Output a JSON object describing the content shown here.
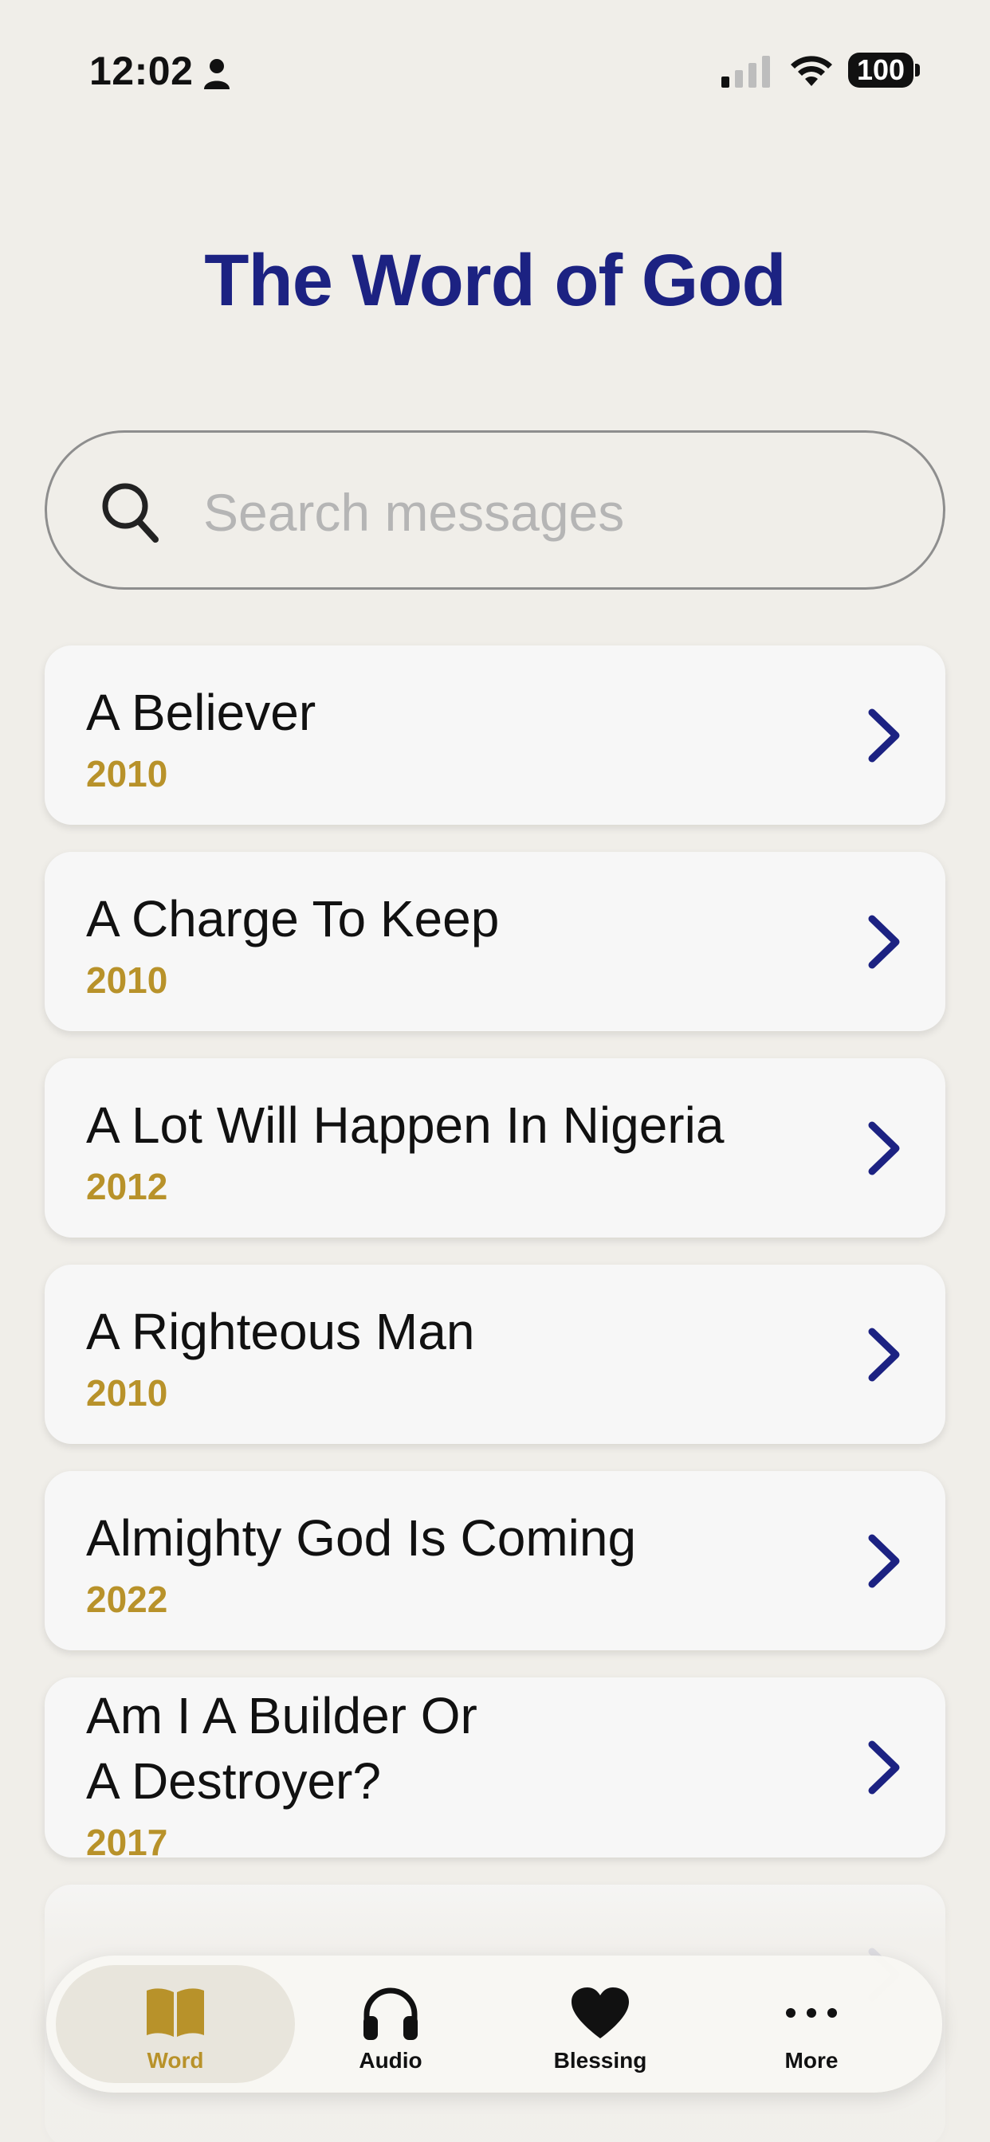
{
  "status_bar": {
    "time": "12:02",
    "battery": "100"
  },
  "header": {
    "title": "The Word of God"
  },
  "search": {
    "placeholder": "Search messages",
    "value": ""
  },
  "messages": [
    {
      "title": "A Believer",
      "year": "2010"
    },
    {
      "title": "A Charge To Keep",
      "year": "2010"
    },
    {
      "title": "A Lot Will Happen In Nigeria",
      "year": "2012"
    },
    {
      "title": "A Righteous Man",
      "year": "2010"
    },
    {
      "title": "Almighty God Is Coming",
      "year": "2022"
    },
    {
      "title_line1": "Am I A Builder Or",
      "title_line2": "A Destroyer?",
      "year": "2017"
    }
  ],
  "tabs": [
    {
      "label": "Word",
      "icon": "book-icon",
      "active": true
    },
    {
      "label": "Audio",
      "icon": "headphones-icon",
      "active": false
    },
    {
      "label": "Blessing",
      "icon": "heart-icon",
      "active": false
    },
    {
      "label": "More",
      "icon": "ellipsis-icon",
      "active": false
    }
  ],
  "colors": {
    "accent": "#1c2282",
    "gold": "#b8922a",
    "background": "#f0eee9"
  }
}
